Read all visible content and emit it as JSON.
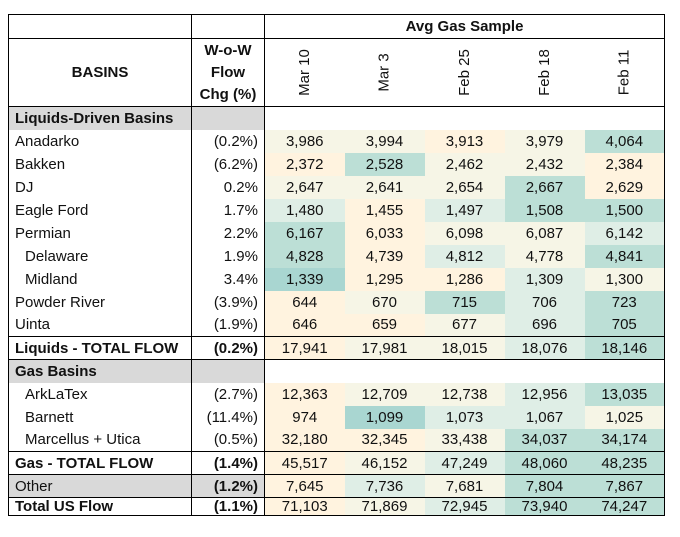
{
  "header": {
    "title": "Avg Gas Sample",
    "basins_label": "BASINS",
    "wow_label_1": "W-o-W",
    "wow_label_2": "Flow",
    "wow_label_3": "Chg (%)",
    "dates": [
      "Mar 10",
      "Mar 3",
      "Feb 25",
      "Feb 18",
      "Feb 11"
    ]
  },
  "heat_colors": {
    "1": "#fff3df",
    "2": "#f6f5e6",
    "3": "#dfeee6",
    "4": "#bcdfd6",
    "5": "#a9d6d1"
  },
  "sections": [
    {
      "title": "Liquids-Driven Basins",
      "rows": [
        {
          "name": "Anadarko",
          "wow": "(0.2%)",
          "values": [
            "3,986",
            "3,994",
            "3,913",
            "3,979",
            "4,064"
          ],
          "heat": [
            2,
            2,
            1,
            2,
            4
          ]
        },
        {
          "name": "Bakken",
          "wow": "(6.2%)",
          "values": [
            "2,372",
            "2,528",
            "2,462",
            "2,432",
            "2,384"
          ],
          "heat": [
            1,
            4,
            2,
            2,
            1
          ]
        },
        {
          "name": "DJ",
          "wow": "0.2%",
          "values": [
            "2,647",
            "2,641",
            "2,654",
            "2,667",
            "2,629"
          ],
          "heat": [
            2,
            2,
            2,
            4,
            1
          ]
        },
        {
          "name": "Eagle Ford",
          "wow": "1.7%",
          "values": [
            "1,480",
            "1,455",
            "1,497",
            "1,508",
            "1,500"
          ],
          "heat": [
            3,
            1,
            3,
            4,
            4
          ]
        },
        {
          "name": "Permian",
          "wow": "2.2%",
          "values": [
            "6,167",
            "6,033",
            "6,098",
            "6,087",
            "6,142"
          ],
          "heat": [
            4,
            1,
            2,
            2,
            3
          ]
        },
        {
          "name": "Delaware",
          "wow": "1.9%",
          "indent": true,
          "values": [
            "4,828",
            "4,739",
            "4,812",
            "4,778",
            "4,841"
          ],
          "heat": [
            4,
            1,
            3,
            2,
            4
          ]
        },
        {
          "name": "Midland",
          "wow": "3.4%",
          "indent": true,
          "values": [
            "1,339",
            "1,295",
            "1,286",
            "1,309",
            "1,300"
          ],
          "heat": [
            5,
            1,
            1,
            3,
            2
          ]
        },
        {
          "name": "Powder River",
          "wow": "(3.9%)",
          "values": [
            "644",
            "670",
            "715",
            "706",
            "723"
          ],
          "heat": [
            1,
            2,
            4,
            3,
            4
          ]
        },
        {
          "name": "Uinta",
          "wow": "(1.9%)",
          "values": [
            "646",
            "659",
            "677",
            "696",
            "705"
          ],
          "heat": [
            1,
            1,
            2,
            3,
            4
          ]
        }
      ],
      "total": {
        "name": "Liquids - TOTAL FLOW",
        "wow": "(0.2%)",
        "values": [
          "17,941",
          "17,981",
          "18,015",
          "18,076",
          "18,146"
        ],
        "heat": [
          1,
          2,
          2,
          3,
          4
        ]
      }
    },
    {
      "title": "Gas Basins",
      "rows": [
        {
          "name": "ArkLaTex",
          "wow": "(2.7%)",
          "indent": true,
          "values": [
            "12,363",
            "12,709",
            "12,738",
            "12,956",
            "13,035"
          ],
          "heat": [
            1,
            2,
            2,
            3,
            4
          ]
        },
        {
          "name": "Barnett",
          "wow": "(11.4%)",
          "indent": true,
          "values": [
            "974",
            "1,099",
            "1,073",
            "1,067",
            "1,025"
          ],
          "heat": [
            1,
            5,
            3,
            3,
            2
          ]
        },
        {
          "name": "Marcellus + Utica",
          "wow": "(0.5%)",
          "indent": true,
          "values": [
            "32,180",
            "32,345",
            "33,438",
            "34,037",
            "34,174"
          ],
          "heat": [
            1,
            1,
            2,
            4,
            4
          ]
        }
      ],
      "total": {
        "name": "Gas - TOTAL FLOW",
        "wow": "(1.4%)",
        "values": [
          "45,517",
          "46,152",
          "47,249",
          "48,060",
          "48,235"
        ],
        "heat": [
          1,
          2,
          3,
          4,
          4
        ]
      }
    }
  ],
  "other": {
    "name": "Other",
    "wow": "(1.2%)",
    "values": [
      "7,645",
      "7,736",
      "7,681",
      "7,804",
      "7,867"
    ],
    "heat": [
      1,
      3,
      2,
      4,
      4
    ]
  },
  "grand_total": {
    "name": "Total US Flow",
    "wow": "(1.1%)",
    "values": [
      "71,103",
      "71,869",
      "72,945",
      "73,940",
      "74,247"
    ],
    "heat": [
      1,
      2,
      3,
      4,
      4
    ]
  }
}
